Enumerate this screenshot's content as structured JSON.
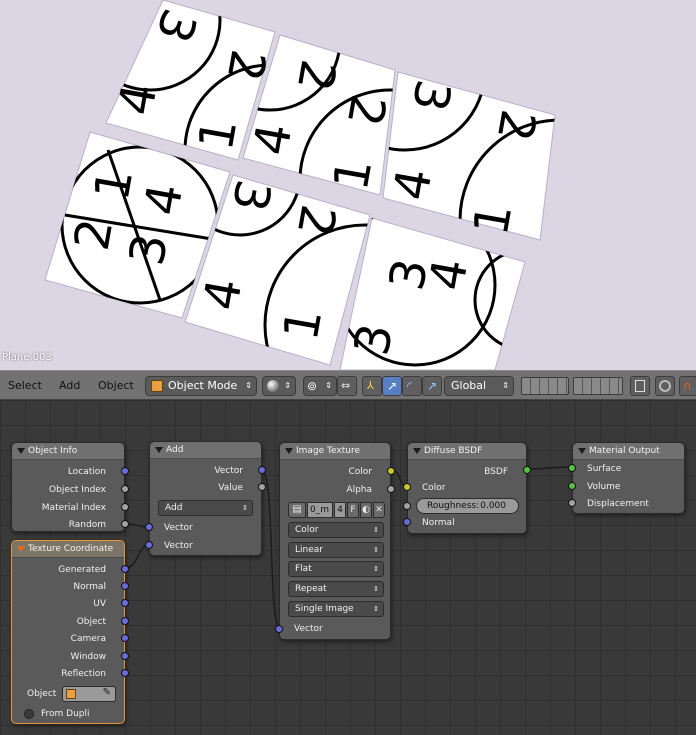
{
  "viewport": {
    "object_label": "Plane.003"
  },
  "header": {
    "menus": [
      "Select",
      "Add",
      "Object"
    ],
    "mode": "Object Mode",
    "orientation": "Global"
  },
  "nodes": {
    "object_info": {
      "title": "Object Info",
      "outputs": [
        "Location",
        "Object Index",
        "Material Index",
        "Random"
      ]
    },
    "texture_coordinate": {
      "title": "Texture Coordinate",
      "outputs": [
        "Generated",
        "Normal",
        "UV",
        "Object",
        "Camera",
        "Window",
        "Reflection"
      ],
      "object_label": "Object",
      "from_dupli": "From Dupli"
    },
    "add": {
      "title": "Add",
      "outputs": [
        "Vector",
        "Value"
      ],
      "operation": "Add",
      "inputs": [
        "Vector",
        "Vector"
      ]
    },
    "image_texture": {
      "title": "Image Texture",
      "outputs": [
        "Color",
        "Alpha"
      ],
      "image_name": "0_m",
      "users": "4",
      "fake": "F",
      "color_space": "Color",
      "interpolation": "Linear",
      "projection": "Flat",
      "extension": "Repeat",
      "source": "Single Image",
      "inputs": [
        "Vector"
      ]
    },
    "diffuse": {
      "title": "Diffuse BSDF",
      "output": "BSDF",
      "inputs": [
        "Color",
        "Normal"
      ],
      "roughness_label": "Roughness:",
      "roughness_value": "0.000"
    },
    "material_output": {
      "title": "Material Output",
      "inputs": [
        "Surface",
        "Volume",
        "Displacement"
      ]
    }
  }
}
